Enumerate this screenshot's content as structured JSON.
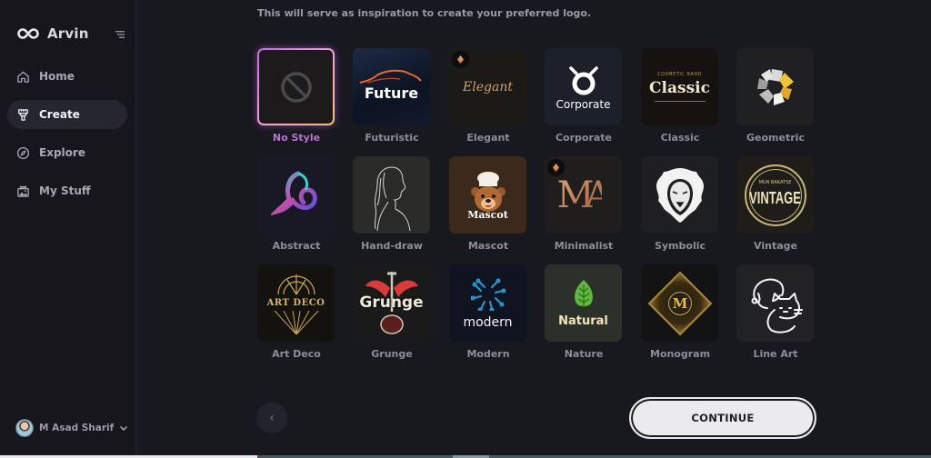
{
  "app": {
    "name": "Arvin",
    "collapse_icon": "sidebar-collapse-icon"
  },
  "sidebar": {
    "items": [
      {
        "label": "Home",
        "icon": "home-icon",
        "active": false
      },
      {
        "label": "Create",
        "icon": "brush-icon",
        "active": true
      },
      {
        "label": "Explore",
        "icon": "compass-icon",
        "active": false
      },
      {
        "label": "My Stuff",
        "icon": "image-folder-icon",
        "active": false
      }
    ],
    "user": {
      "name": "M Asad Sharif",
      "chevron": "chevron-down-icon"
    }
  },
  "main": {
    "subtitle": "This will serve as inspiration to create your preferred logo.",
    "selected_style": "No Style",
    "styles": [
      {
        "label": "No Style",
        "preview": "ban-icon"
      },
      {
        "label": "Futuristic",
        "preview_text": "Future"
      },
      {
        "label": "Elegant",
        "preview_text": "Elegant",
        "premium": true
      },
      {
        "label": "Corporate",
        "preview_text": "Corporate"
      },
      {
        "label": "Classic",
        "preview_text": "Classic",
        "preview_subtext": "COSMETIC BAND"
      },
      {
        "label": "Geometric",
        "preview": "geometric-flower"
      },
      {
        "label": "Abstract",
        "preview": "abstract-swirl"
      },
      {
        "label": "Hand-draw",
        "preview": "line-portrait"
      },
      {
        "label": "Mascot",
        "preview_text": "Mascot"
      },
      {
        "label": "Minimalist",
        "preview_text": "MA",
        "premium": true
      },
      {
        "label": "Symbolic",
        "preview": "lion-head"
      },
      {
        "label": "Vintage",
        "preview_text": "VINTAGE",
        "preview_subtext": "MUN BAKATSE"
      },
      {
        "label": "Art Deco",
        "preview_text": "ART DECO"
      },
      {
        "label": "Grunge",
        "preview_text": "Grunge"
      },
      {
        "label": "Modern",
        "preview_text": "modern"
      },
      {
        "label": "Nature",
        "preview_text": "Natural"
      },
      {
        "label": "Monogram",
        "preview_text": "M"
      },
      {
        "label": "Line Art",
        "preview": "dog-cat-line"
      }
    ],
    "back_label": "‹",
    "continue_label": "CONTINUE"
  },
  "colors": {
    "background": "#18181f",
    "sidebar": "#16161c",
    "selected_label": "#b673d1",
    "continue_bg": "#ebebed"
  }
}
